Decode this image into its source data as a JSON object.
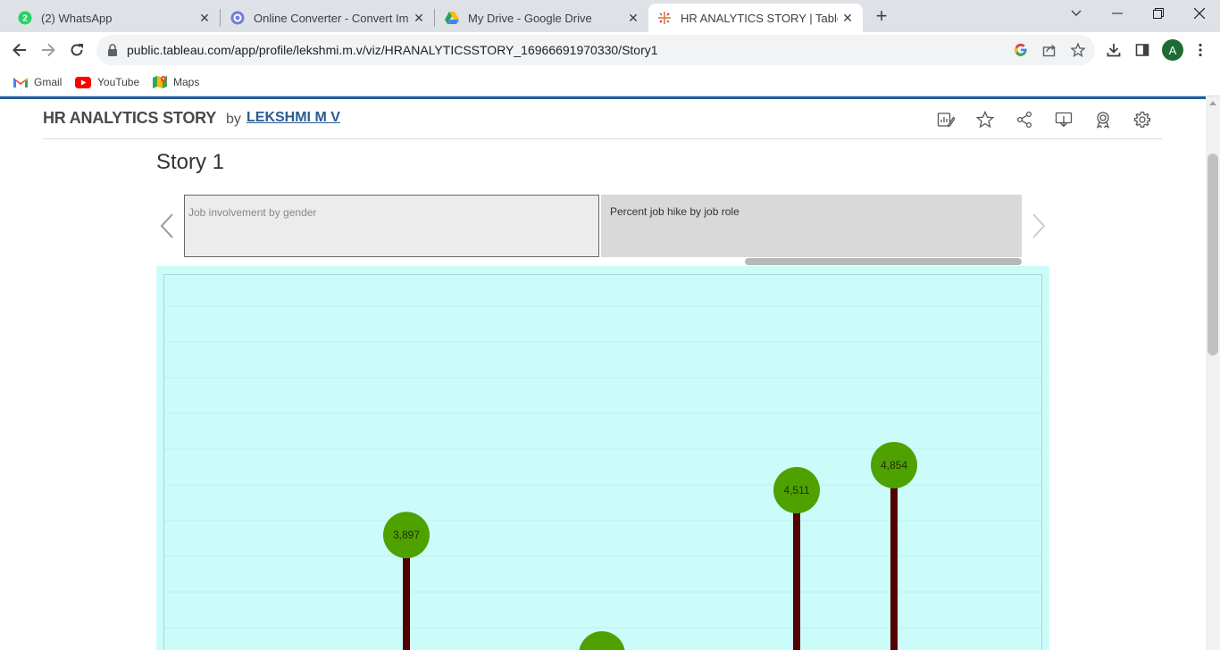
{
  "browser": {
    "tabs": [
      {
        "title": "(2) WhatsApp",
        "icon": "whatsapp-icon",
        "active": false
      },
      {
        "title": "Online Converter - Convert Imag",
        "icon": "converter-icon",
        "active": false
      },
      {
        "title": "My Drive - Google Drive",
        "icon": "google-drive-icon",
        "active": false
      },
      {
        "title": "HR ANALYTICS STORY | Tableau",
        "icon": "tableau-icon",
        "active": true
      }
    ],
    "whatsapp_badge": "2",
    "url": "public.tableau.com/app/profile/lekshmi.m.v/viz/HRANALYTICSSTORY_16966691970330/Story1",
    "avatar_letter": "A",
    "bookmarks": [
      {
        "label": "Gmail",
        "icon": "gmail-icon"
      },
      {
        "label": "YouTube",
        "icon": "youtube-icon"
      },
      {
        "label": "Maps",
        "icon": "maps-icon"
      }
    ]
  },
  "tableau": {
    "viz_title": "HR ANALYTICS STORY",
    "by": "by",
    "author": "LEKSHMI M V",
    "story_title": "Story 1",
    "story_points": [
      {
        "label": "Job involvement by gender",
        "selected": false
      },
      {
        "label": "Percent job hike by job role",
        "selected": true
      }
    ]
  },
  "colors": {
    "viz_background": "#ccfcfa",
    "lollipop_head": "#4fa100",
    "lollipop_stem": "#520000",
    "accent_blue": "#1f5f9e"
  },
  "chart_data": {
    "type": "lollipop",
    "title": "",
    "points": [
      {
        "label": "3,897",
        "value": 3897
      },
      {
        "label": "",
        "value": 0
      },
      {
        "label": "4,511",
        "value": 4511
      },
      {
        "label": "4,854",
        "value": 4854
      }
    ]
  }
}
